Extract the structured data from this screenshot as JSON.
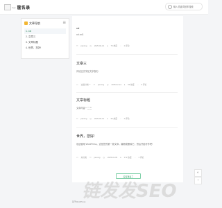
{
  "header": {
    "logo_alt": "logo",
    "site_name": "筐名录",
    "search_placeholder": "输入关键词回车搜索"
  },
  "sidebar": {
    "title": "文章导航",
    "items": [
      {
        "label": "1. xxl"
      },
      {
        "label": "2. 文章三"
      },
      {
        "label": "3. 文章标题"
      },
      {
        "label": "4. 世界，您好!"
      }
    ]
  },
  "posts": [
    {
      "title": "xxl",
      "excerpt": "xxl.xxl1",
      "author": "jiaming",
      "date": "2025-02-14",
      "views": "76 热度",
      "comments": "0 评论"
    },
    {
      "title": "文章三",
      "excerpt": "评论区文字区文字部分",
      "category": "这是分类一",
      "author": "jiaming",
      "date": "2025-02-14",
      "views": "64 热度",
      "comments": "0 评论"
    },
    {
      "title": "文章标题",
      "excerpt": "文章内容一二三",
      "author": "jiaming",
      "date": "2025-02-14",
      "views": "94 热度",
      "comments": "0 评论"
    },
    {
      "title": "世界，您好!",
      "excerpt": "欢迎使用 WordPress。这是您的第一篇文章。编辑或删除它，然后开始写作吧!",
      "category": "未分类",
      "author": "jiaming",
      "date": "2025-02-05",
      "views": "172 热度",
      "comments": "1 评论"
    }
  ],
  "load_more": "没有更多了",
  "watermark": "链发发SEO",
  "footer": "基于WordPress",
  "float_buttons": {
    "theme": "◐",
    "top": "↑"
  }
}
